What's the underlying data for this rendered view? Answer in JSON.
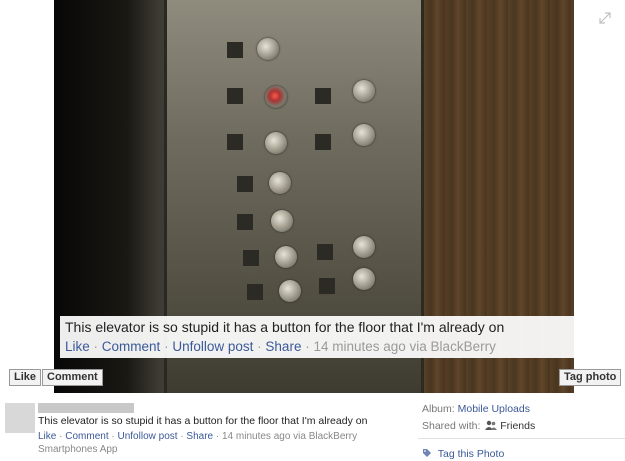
{
  "photo": {
    "caption_message": "This elevator is so stupid it has a button for the floor that I'm already on",
    "caption_actions": [
      "Like",
      "Comment",
      "Unfollow post",
      "Share"
    ],
    "caption_time": "14 minutes ago via BlackBerry",
    "expand_icon": "expand-icon"
  },
  "buttons": {
    "like": "Like",
    "comment": "Comment",
    "tag_photo": "Tag photo"
  },
  "post": {
    "message": "This elevator is so stupid it has a button for the floor that I'm already on",
    "actions": [
      "Like",
      "Comment",
      "Unfollow post",
      "Share"
    ],
    "time": "14 minutes ago via BlackBerry",
    "app": "Smartphones App"
  },
  "sidebar": {
    "album_label": "Album:",
    "album_value": "Mobile Uploads",
    "shared_label": "Shared with:",
    "shared_icon": "friends-icon",
    "shared_value": "Friends",
    "tag_icon": "tag-icon",
    "tag_label": "Tag this Photo"
  },
  "colors": {
    "link": "#3b5998",
    "meta_gray": "#9a9a9a"
  }
}
